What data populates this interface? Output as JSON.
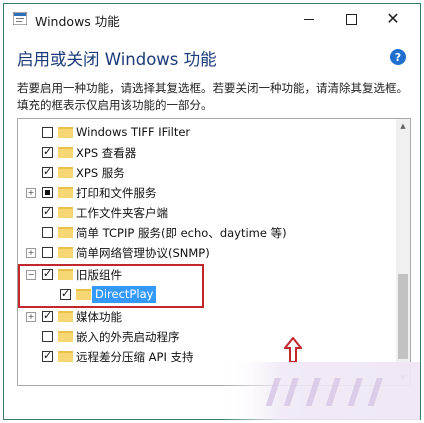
{
  "window": {
    "title": "Windows 功能",
    "controls": {
      "minimize": "minimize-icon",
      "maximize": "maximize-icon",
      "close": "close-icon"
    }
  },
  "heading": "启用或关闭 Windows 功能",
  "help_icon_text": "?",
  "description": "若要启用一种功能，请选择其复选框。若要关闭一种功能，请清除其复选框。填充的框表示仅启用该功能的一部分。",
  "features": [
    {
      "label": "Windows TIFF IFilter",
      "state": "unchecked",
      "expander": ""
    },
    {
      "label": "XPS 查看器",
      "state": "checked",
      "expander": ""
    },
    {
      "label": "XPS 服务",
      "state": "checked",
      "expander": ""
    },
    {
      "label": "打印和文件服务",
      "state": "partial",
      "expander": "+"
    },
    {
      "label": "工作文件夹客户端",
      "state": "checked",
      "expander": ""
    },
    {
      "label": "简单 TCPIP 服务(即 echo、daytime 等)",
      "state": "unchecked",
      "expander": ""
    },
    {
      "label": "简单网络管理协议(SNMP)",
      "state": "unchecked",
      "expander": "+"
    },
    {
      "label": "旧版组件",
      "state": "checked",
      "expander": "−"
    },
    {
      "label": "DirectPlay",
      "state": "checked",
      "expander": "",
      "selected": true
    },
    {
      "label": "媒体功能",
      "state": "checked",
      "expander": "+"
    },
    {
      "label": "嵌入的外壳启动程序",
      "state": "unchecked",
      "expander": ""
    },
    {
      "label": "远程差分压缩 API 支持",
      "state": "checked",
      "expander": ""
    }
  ],
  "colors": {
    "heading": "#1b3a79",
    "selection": "#3399ff",
    "annotation": "#c0282e",
    "folder": "#f7d774"
  }
}
